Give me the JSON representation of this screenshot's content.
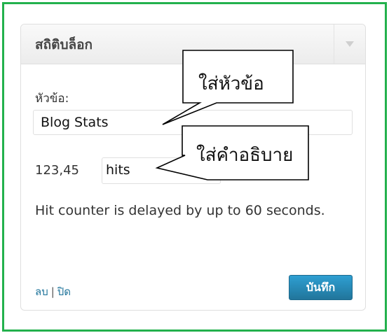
{
  "widget": {
    "title": "สถิติบล็อก",
    "toggle_icon": "triangle-down-icon"
  },
  "form": {
    "title_label": "หัวข้อ:",
    "title_value": "Blog Stats",
    "hits_count": "123,45",
    "hits_value": "hits",
    "note": "Hit counter is delayed by up to 60 seconds."
  },
  "footer": {
    "delete_label": "ลบ",
    "separator": "|",
    "close_label": "ปิด",
    "save_label": "บันทึก"
  },
  "callouts": {
    "title_hint": "ใส่หัวข้อ",
    "description_hint": "ใส่คำอธิบาย"
  },
  "colors": {
    "frame_border": "#23b14d",
    "accent": "#21759b"
  }
}
